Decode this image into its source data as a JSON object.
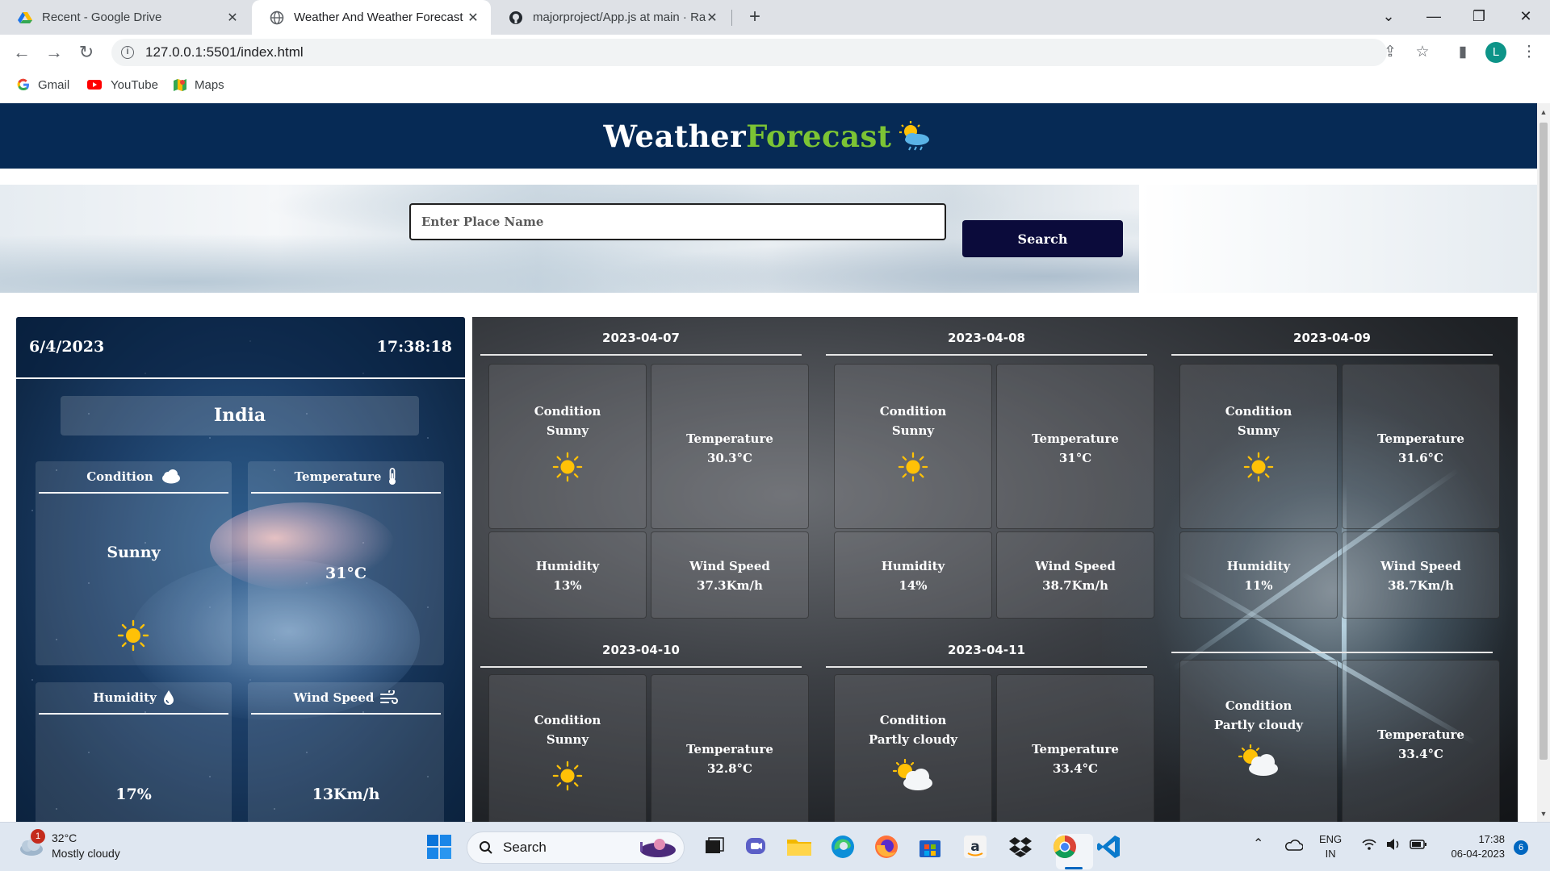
{
  "browser": {
    "tabs": [
      {
        "title": "Recent - Google Drive",
        "icon": "google-drive-icon"
      },
      {
        "title": "Weather And Weather Forecast -",
        "icon": "globe-icon"
      },
      {
        "title": "majorproject/App.js at main · Rai",
        "icon": "github-icon"
      }
    ],
    "url": "127.0.0.1:5501/index.html",
    "profile_initial": "L",
    "bookmarks": [
      {
        "label": "Gmail",
        "icon": "google-icon"
      },
      {
        "label": "YouTube",
        "icon": "youtube-icon"
      },
      {
        "label": "Maps",
        "icon": "maps-icon"
      }
    ]
  },
  "site": {
    "logo_white": "Weather",
    "logo_green": "Forecast",
    "brand_colors": {
      "header_bg": "#062a55",
      "logo_green": "#7cc434",
      "button_bg": "#0b0b3b"
    },
    "search": {
      "placeholder": "Enter Place Name",
      "button_label": "Search"
    }
  },
  "current": {
    "date": "6/4/2023",
    "time": "17:38:18",
    "place": "India",
    "condition": {
      "label": "Condition",
      "value": "Sunny",
      "icon": "cloud-icon",
      "value_icon": "sun-icon"
    },
    "temperature": {
      "label": "Temperature",
      "value": "31°C",
      "icon": "thermometer-icon"
    },
    "humidity": {
      "label": "Humidity",
      "value": "17%",
      "icon": "droplet-icon"
    },
    "wind": {
      "label": "Wind Speed",
      "value": "13Km/h",
      "icon": "wind-icon"
    }
  },
  "forecast": {
    "labels": {
      "condition": "Condition",
      "temperature": "Temperature",
      "humidity": "Humidity",
      "wind": "Wind Speed"
    },
    "days": [
      {
        "date": "2023-04-07",
        "condition": "Sunny",
        "temperature": "30.3°C",
        "humidity": "13%",
        "wind": "37.3Km/h",
        "icon": "sun-icon"
      },
      {
        "date": "2023-04-08",
        "condition": "Sunny",
        "temperature": "31°C",
        "humidity": "14%",
        "wind": "38.7Km/h",
        "icon": "sun-icon"
      },
      {
        "date": "2023-04-09",
        "condition": "Sunny",
        "temperature": "31.6°C",
        "humidity": "11%",
        "wind": "38.7Km/h",
        "icon": "sun-icon"
      },
      {
        "date": "2023-04-10",
        "condition": "Sunny",
        "temperature": "32.8°C",
        "icon": "sun-icon"
      },
      {
        "date": "2023-04-11",
        "condition": "Partly cloudy",
        "temperature": "33.4°C",
        "icon": "partly-cloudy-icon"
      },
      {
        "condition": "Partly cloudy",
        "temperature": "33.4°C",
        "icon": "partly-cloudy-icon"
      }
    ]
  },
  "taskbar": {
    "weather_temp": "32°C",
    "weather_desc": "Mostly cloudy",
    "weather_badge": "1",
    "search_label": "Search",
    "lang": "ENG",
    "region": "IN",
    "time": "17:38",
    "date": "06-04-2023",
    "notifications": "6"
  }
}
